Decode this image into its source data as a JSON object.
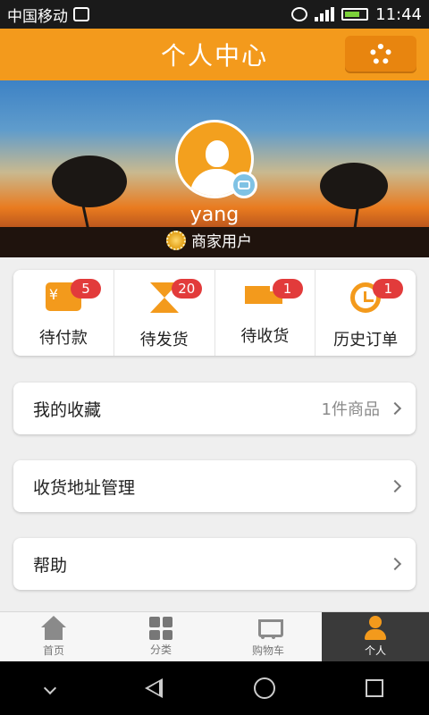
{
  "status_bar": {
    "carrier": "中国移动",
    "time": "11:44"
  },
  "header": {
    "title": "个人中心",
    "settings_icon": "gear-icon"
  },
  "profile": {
    "username": "yang",
    "user_type": "商家用户"
  },
  "orders": [
    {
      "label": "待付款",
      "badge": "5",
      "icon": "wallet-icon"
    },
    {
      "label": "待发货",
      "badge": "20",
      "icon": "hourglass-icon"
    },
    {
      "label": "待收货",
      "badge": "1",
      "icon": "truck-icon"
    },
    {
      "label": "历史订单",
      "badge": "1",
      "icon": "clock-icon"
    }
  ],
  "menu": {
    "favorites": {
      "label": "我的收藏",
      "value": "1件商品"
    },
    "address": {
      "label": "收货地址管理"
    },
    "help": {
      "label": "帮助"
    }
  },
  "tabs": [
    {
      "label": "首页",
      "icon": "home-icon"
    },
    {
      "label": "分类",
      "icon": "grid-icon"
    },
    {
      "label": "购物车",
      "icon": "cart-icon"
    },
    {
      "label": "个人",
      "icon": "person-icon",
      "active": true
    }
  ],
  "colors": {
    "accent": "#f39a1c",
    "badge": "#e23b3b",
    "active_tab": "#3a3a3a"
  }
}
